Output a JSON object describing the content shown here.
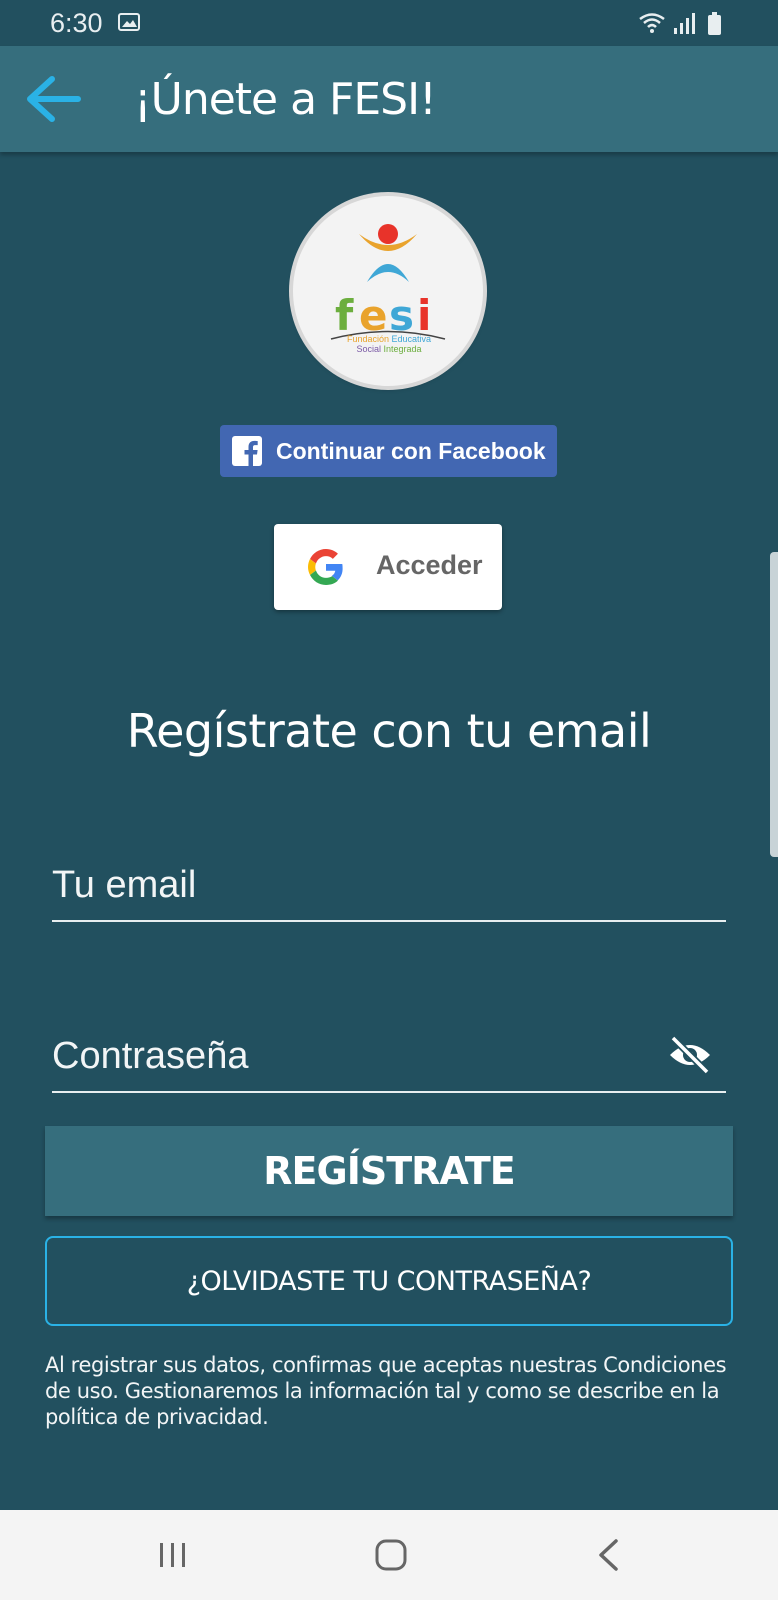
{
  "status_bar": {
    "time": "6:30"
  },
  "app_bar": {
    "title": "¡Únete a FESI!"
  },
  "logo": {
    "brand": "fesi",
    "tagline_1a": "Fundación",
    "tagline_1b": "Educativa",
    "tagline_2a": "Social",
    "tagline_2b": "Integrada"
  },
  "social": {
    "facebook_label": "Continuar con Facebook",
    "google_label": "Acceder"
  },
  "form": {
    "heading": "Regístrate con tu email",
    "email_placeholder": "Tu email",
    "password_placeholder": "Contraseña",
    "register_label": "REGÍSTRATE",
    "forgot_label": "¿OLVIDASTE TU CONTRASEÑA?"
  },
  "terms": "Al registrar sus datos, confirmas que aceptas nuestras Condiciones de uso. Gestionaremos la información tal y como se describe en la política de privacidad.",
  "colors": {
    "background": "#22505f",
    "app_bar": "#366e7d",
    "accent": "#2ab2e6",
    "facebook": "#4267b2"
  }
}
